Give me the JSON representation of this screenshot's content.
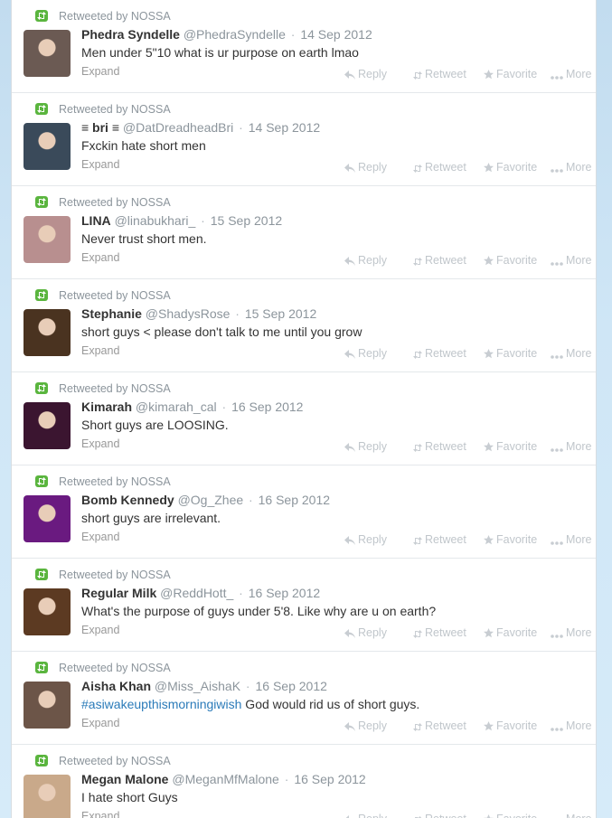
{
  "retweet_label": "Retweeted by NOSSA",
  "expand_label": "Expand",
  "actions": {
    "reply": "Reply",
    "retweet": "Retweet",
    "favorite": "Favorite",
    "more": "More"
  },
  "tweets": [
    {
      "name": "Phedra Syndelle",
      "handle": "@PhedraSyndelle",
      "time": "14 Sep 2012",
      "text": "Men under 5\"10 what is ur purpose on earth lmao",
      "hashtag": "",
      "avatar_color": "#6b5a53"
    },
    {
      "name": "≡ bri ≡",
      "handle": "@DatDreadheadBri",
      "time": "14 Sep 2012",
      "text": "Fxckin hate short men",
      "hashtag": "",
      "avatar_color": "#3a4a5a"
    },
    {
      "name": "LINA",
      "handle": "@linabukhari_",
      "time": "15 Sep 2012",
      "text": "Never trust short men.",
      "hashtag": "",
      "avatar_color": "#b88f8f"
    },
    {
      "name": "Stephanie",
      "handle": "@ShadysRose",
      "time": "15 Sep 2012",
      "text": "short guys < please don't talk to me until you grow",
      "hashtag": "",
      "avatar_color": "#4a3320"
    },
    {
      "name": "Kimarah",
      "handle": "@kimarah_cal",
      "time": "16 Sep 2012",
      "text": "Short guys are LOOSING.",
      "hashtag": "",
      "avatar_color": "#3b1530"
    },
    {
      "name": "Bomb Kennedy",
      "handle": "@Og_Zhee",
      "time": "16 Sep 2012",
      "text": "short guys are irrelevant.",
      "hashtag": "",
      "avatar_color": "#6a1a80"
    },
    {
      "name": "Regular Milk",
      "handle": "@ReddHott_",
      "time": "16 Sep 2012",
      "text": "What's the purpose of guys under 5'8. Like why are u on earth?",
      "hashtag": "",
      "avatar_color": "#5c3a22"
    },
    {
      "name": "Aisha Khan",
      "handle": "@Miss_AishaK",
      "time": "16 Sep 2012",
      "text": " God would rid us of short guys.",
      "hashtag": "#asiwakeupthismorningiwish",
      "avatar_color": "#6c5548"
    },
    {
      "name": "Megan Malone",
      "handle": "@MeganMfMalone",
      "time": "16 Sep 2012",
      "text": "I hate short Guys",
      "hashtag": "",
      "avatar_color": "#c9a98a"
    }
  ]
}
